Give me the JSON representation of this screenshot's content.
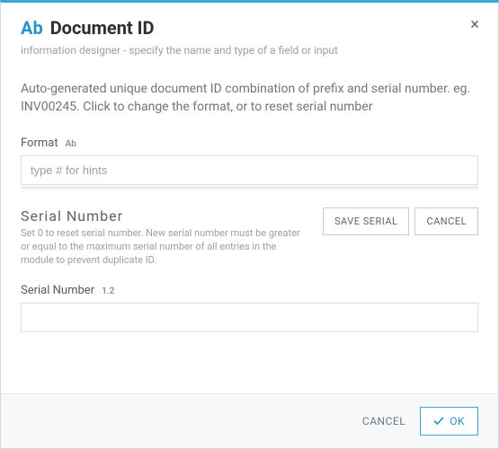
{
  "header": {
    "type_badge": "Ab",
    "title": "Document ID",
    "close_glyph": "×",
    "subtitle": "information designer - specify the name and type of a field or input"
  },
  "description": "Auto-generated unique document ID combination of prefix and serial number. eg. INV00245. Click to change the format, or to reset serial number",
  "format": {
    "label": "Format",
    "mini": "Ab",
    "placeholder": "type # for hints",
    "value": ""
  },
  "serial": {
    "title": "Serial Number",
    "note": "Set 0 to reset serial number. New serial number must be greater or equal to the maximum serial number of all entries in the module to prevent duplicate ID.",
    "save_label": "SAVE SERIAL",
    "cancel_label": "CANCEL",
    "field_label": "Serial Number",
    "field_mini": "1.2",
    "value": ""
  },
  "footer": {
    "cancel": "CANCEL",
    "ok": "OK"
  }
}
